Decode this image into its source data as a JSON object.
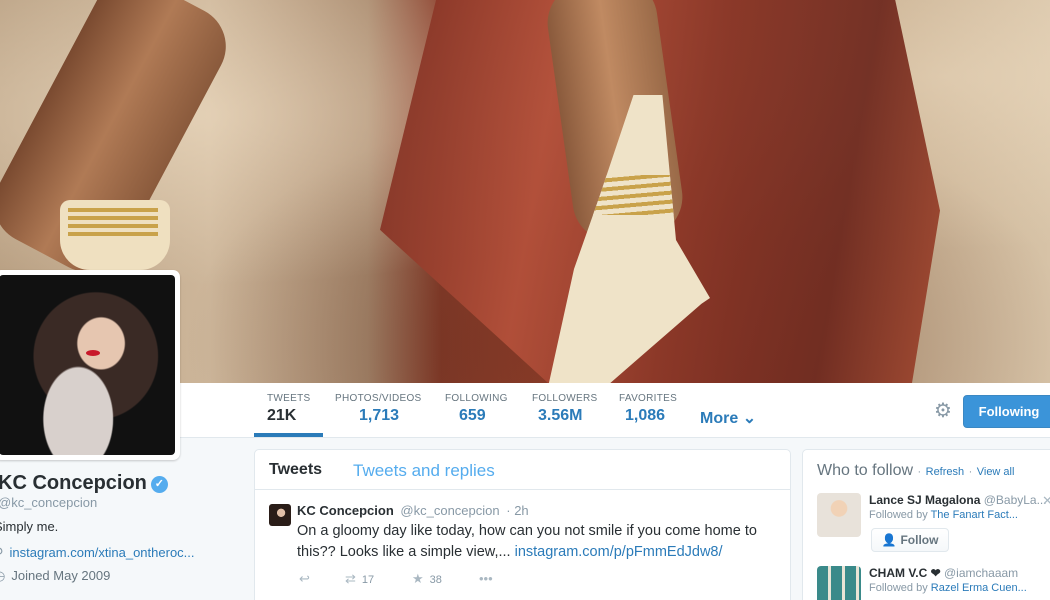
{
  "profile": {
    "name": "KC Concepcion",
    "handle": "@kc_concepcion",
    "bio": "Simply me.",
    "link": "instagram.com/xtina_ontheroc...",
    "joined": "Joined May 2009"
  },
  "stats": [
    {
      "label": "TWEETS",
      "value": "21K"
    },
    {
      "label": "PHOTOS/VIDEOS",
      "value": "1,713"
    },
    {
      "label": "FOLLOWING",
      "value": "659"
    },
    {
      "label": "FOLLOWERS",
      "value": "3.56M"
    },
    {
      "label": "FAVORITES",
      "value": "1,086"
    }
  ],
  "nav": {
    "more_label": "More",
    "following_button": "Following"
  },
  "timeline": {
    "tabs": [
      "Tweets",
      "Tweets and replies"
    ],
    "tweet": {
      "author": "KC Concepcion",
      "handle": "@kc_concepcion",
      "time": "· 2h",
      "text": "On a gloomy day like today, how can you not smile if you come home to this?? Looks like a simple view,... ",
      "link": "instagram.com/p/pFmmEdJdw8/",
      "retweets": "17",
      "favorites": "38"
    }
  },
  "who_to_follow": {
    "title": "Who to follow",
    "refresh": "Refresh",
    "view_all": "View all",
    "sep": "·",
    "suggestions": [
      {
        "name": "Lance SJ Magalona",
        "handle": "@BabyLa...",
        "followed_by_prefix": "Followed by",
        "followed_by": "The Fanart Fact...",
        "follow_label": "Follow"
      },
      {
        "name": "CHAM V.C ❤",
        "handle": "@iamchaaam",
        "followed_by_prefix": "Followed by",
        "followed_by": "Razel Erma Cuen..."
      }
    ]
  },
  "colors": {
    "accent": "#2b7bb9",
    "button": "#3b94d9",
    "muted": "#8899a6"
  }
}
